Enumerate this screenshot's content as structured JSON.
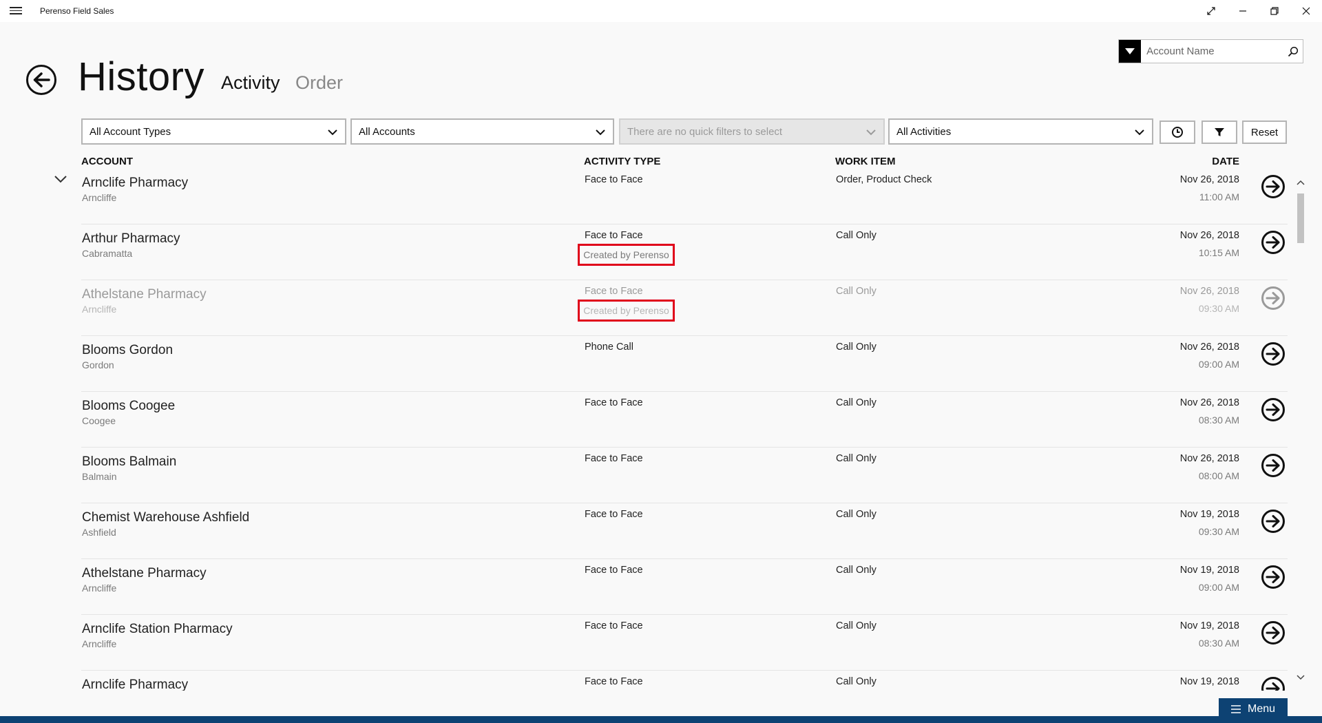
{
  "app": {
    "title": "Perenso Field Sales",
    "window_controls": [
      "resize-icon",
      "minimize-icon",
      "restore-icon",
      "close-icon"
    ]
  },
  "header": {
    "title": "History",
    "tabs": [
      {
        "label": "Activity",
        "active": true
      },
      {
        "label": "Order",
        "active": false
      }
    ]
  },
  "search": {
    "placeholder": "Account Name"
  },
  "filters": {
    "account_types": "All Account Types",
    "accounts": "All Accounts",
    "quick_filters": "There are no quick filters to select",
    "activities": "All Activities",
    "reset_label": "Reset"
  },
  "columns": {
    "account": "ACCOUNT",
    "activity_type": "ACTIVITY TYPE",
    "work_item": "WORK ITEM",
    "date": "DATE"
  },
  "rows": [
    {
      "name": "Arnclife Pharmacy",
      "suburb": "Arncliffe",
      "activity": "Face to Face",
      "created_by": "",
      "work_item": "Order, Product Check",
      "date": "Nov 26, 2018",
      "time": "11:00 AM"
    },
    {
      "name": "Arthur Pharmacy",
      "suburb": "Cabramatta",
      "activity": "Face to Face",
      "created_by": "Created by Perenso",
      "work_item": "Call Only",
      "date": "Nov 26, 2018",
      "time": "10:15 AM"
    },
    {
      "name": "Athelstane Pharmacy",
      "suburb": "Arncliffe",
      "activity": "Face to Face",
      "created_by": "Created by Perenso",
      "work_item": "Call Only",
      "date": "Nov 26, 2018",
      "time": "09:30 AM"
    },
    {
      "name": "Blooms Gordon",
      "suburb": "Gordon",
      "activity": "Phone Call",
      "created_by": "",
      "work_item": "Call Only",
      "date": "Nov 26, 2018",
      "time": "09:00 AM"
    },
    {
      "name": "Blooms Coogee",
      "suburb": "Coogee",
      "activity": "Face to Face",
      "created_by": "",
      "work_item": "Call Only",
      "date": "Nov 26, 2018",
      "time": "08:30 AM"
    },
    {
      "name": "Blooms Balmain",
      "suburb": "Balmain",
      "activity": "Face to Face",
      "created_by": "",
      "work_item": "Call Only",
      "date": "Nov 26, 2018",
      "time": "08:00 AM"
    },
    {
      "name": "Chemist Warehouse Ashfield",
      "suburb": "Ashfield",
      "activity": "Face to Face",
      "created_by": "",
      "work_item": "Call Only",
      "date": "Nov 19, 2018",
      "time": "09:30 AM"
    },
    {
      "name": "Athelstane Pharmacy",
      "suburb": "Arncliffe",
      "activity": "Face to Face",
      "created_by": "",
      "work_item": "Call Only",
      "date": "Nov 19, 2018",
      "time": "09:00 AM"
    },
    {
      "name": "Arnclife Station Pharmacy",
      "suburb": "Arncliffe",
      "activity": "Face to Face",
      "created_by": "",
      "work_item": "Call Only",
      "date": "Nov 19, 2018",
      "time": "08:30 AM"
    },
    {
      "name": "Arnclife Pharmacy",
      "suburb": "",
      "activity": "Face to Face",
      "created_by": "",
      "work_item": "Call Only",
      "date": "Nov 19, 2018",
      "time": ""
    }
  ],
  "bottom": {
    "menu_label": "Menu"
  },
  "colors": {
    "accent": "#0d4273",
    "highlight_box": "#e0001a"
  }
}
